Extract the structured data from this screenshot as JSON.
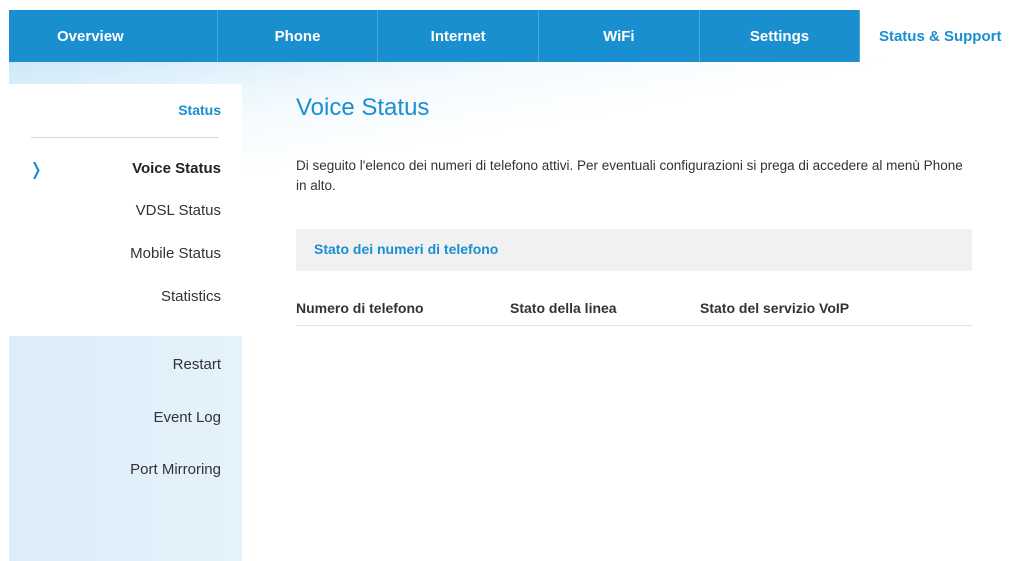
{
  "nav": {
    "tabs": [
      {
        "label": "Overview"
      },
      {
        "label": "Phone"
      },
      {
        "label": "Internet"
      },
      {
        "label": "WiFi"
      },
      {
        "label": "Settings"
      },
      {
        "label": "Status & Support"
      }
    ],
    "active_tab": "Status & Support"
  },
  "sidebar": {
    "heading": "Status",
    "items": [
      {
        "label": "Voice Status"
      },
      {
        "label": "VDSL Status"
      },
      {
        "label": "Mobile Status"
      },
      {
        "label": "Statistics"
      },
      {
        "label": "Restart"
      },
      {
        "label": "Event Log"
      },
      {
        "label": "Port Mirroring"
      }
    ],
    "active_item": "Voice Status",
    "chevron_icon": "chevron-right-icon"
  },
  "main": {
    "title": "Voice Status",
    "intro": "Di seguito l'elenco dei numeri di telefono attivi. Per eventuali configurazioni si prega di accedere al menù Phone in alto.",
    "section_title": "Stato dei numeri di telefono",
    "table_headers": [
      "Numero di telefono",
      "Stato della linea",
      "Stato del servizio VoIP"
    ]
  },
  "colors": {
    "accent": "#1a8fd0",
    "sidebar_lower_bg": "#dcedf8",
    "section_bg": "#f1f1f1"
  }
}
